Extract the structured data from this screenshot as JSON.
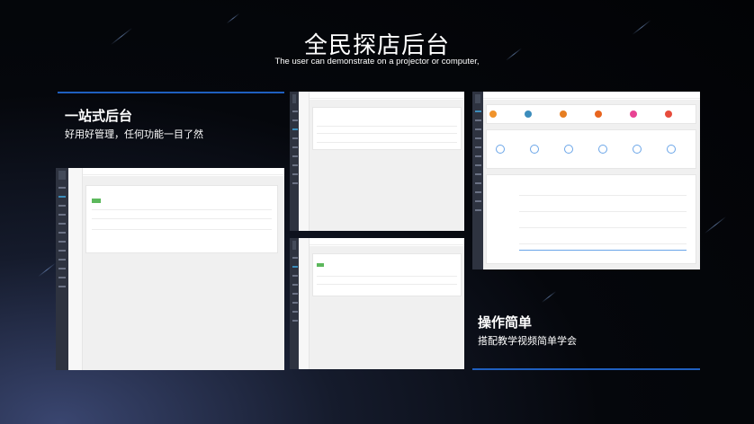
{
  "header": {
    "title": "全民探店后台",
    "subtitle": "The user can demonstrate on a projector or computer,"
  },
  "features": [
    {
      "title": "一站式后台",
      "desc": "好用好管理，任何功能一目了然"
    },
    {
      "title": "操作简单",
      "desc": "搭配教学视频简单学会"
    }
  ],
  "colors": {
    "accent_rule": "#1f5fbf",
    "sidebar": "#2e3340",
    "add_button": "#5cb85c"
  },
  "screens": {
    "large": {
      "sidebar_icons": [
        "home-icon",
        "user-icon",
        "doc-icon",
        "list-icon",
        "cart-icon",
        "chart-icon",
        "gear-icon",
        "tag-icon",
        "star-icon",
        "bell-icon",
        "wechat-icon",
        "settings-icon"
      ]
    },
    "dashboard": {
      "stat_colors": [
        "#f0932b",
        "#3c8dbc",
        "#e67e22",
        "#e8651f",
        "#e84393",
        "#e74c3c"
      ]
    }
  }
}
